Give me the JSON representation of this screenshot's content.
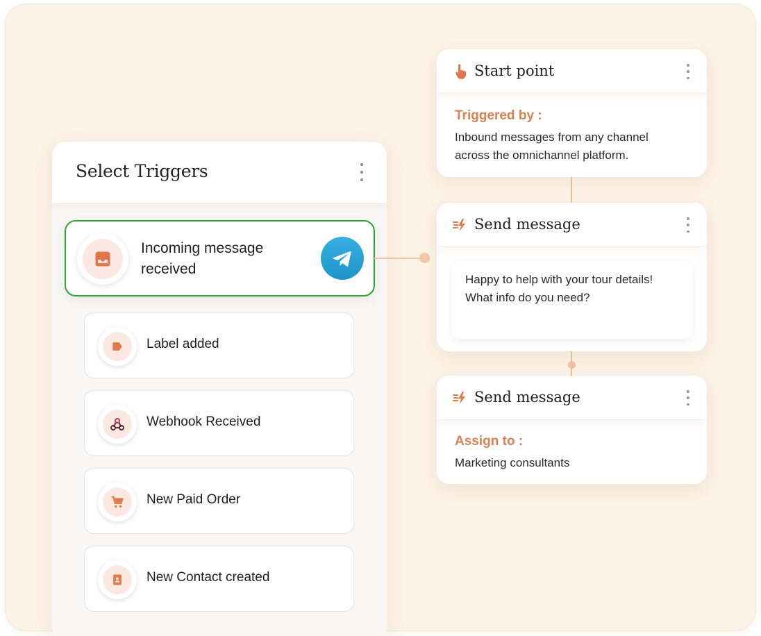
{
  "trigger_panel": {
    "title": "Select Triggers",
    "selected": {
      "label": "Incoming message received",
      "icon": "inbox-icon",
      "channel_icon": "telegram-icon"
    },
    "items": [
      {
        "label": "Label added",
        "icon": "label-tag-icon"
      },
      {
        "label": "Webhook Received",
        "icon": "webhook-icon"
      },
      {
        "label": "New Paid Order",
        "icon": "cart-icon"
      },
      {
        "label": "New Contact created",
        "icon": "contact-card-icon"
      }
    ]
  },
  "flow": {
    "start": {
      "title": "Start point",
      "icon": "pointer-hand-icon",
      "subtitle": "Triggered by :",
      "text": "Inbound messages from any channel across the omnichannel platform."
    },
    "send_message_1": {
      "title": "Send message",
      "icon": "send-bolt-icon",
      "message": "Happy to help with your tour details! What info do you need?"
    },
    "send_message_2": {
      "title": "Send message",
      "icon": "send-bolt-icon",
      "subtitle": "Assign to :",
      "text": "Marketing consultants"
    }
  },
  "colors": {
    "background": "#fbf3e6",
    "accent": "#d9824f",
    "selected_border": "#2ea52e",
    "telegram": "#2aa3dc",
    "connector": "#efbf9d"
  }
}
